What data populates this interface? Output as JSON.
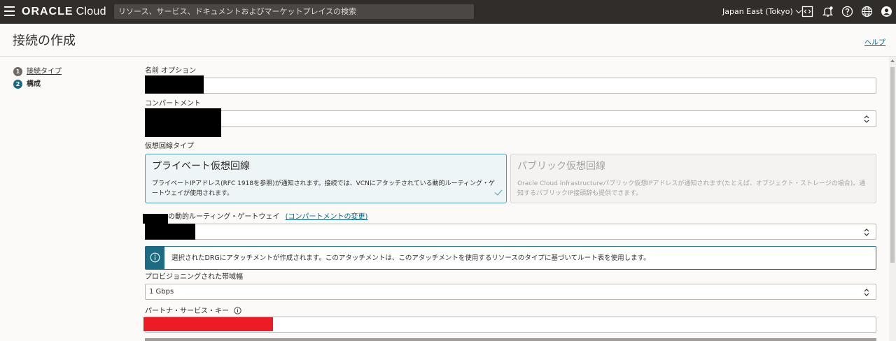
{
  "topbar": {
    "brand_bold": "ORACLE",
    "brand_rest": "Cloud",
    "search_placeholder": "リソース、サービス、ドキュメントおよびマーケットプレイスの検索",
    "region": "Japan East (Tokyo)",
    "icons": [
      "menu-icon",
      "code-editor-icon",
      "bell-icon",
      "help-icon",
      "globe-icon",
      "user-icon"
    ]
  },
  "header": {
    "title": "接続の作成",
    "help": "ヘルプ"
  },
  "steps": [
    {
      "number": "1",
      "label": "接続タイプ"
    },
    {
      "number": "2",
      "label": "構成"
    }
  ],
  "form": {
    "name_label": "名前  オプション",
    "compartment_label": "コンパートメント",
    "circuit_type_label": "仮想回線タイプ",
    "private_title": "プライベート仮想回線",
    "private_desc": "プライベートIPアドレス(RFC 1918を参照)が通知されます。接続では、VCNにアタッチされている動的ルーティング・ゲートウェイが使用されます。",
    "public_title": "パブリック仮想回線",
    "public_desc": "Oracle Cloud Infrastructureパブリック仮想IPアドレスが通知されます(たとえば、オブジェクト・ストレージの場合)。通知するパブリックIP接頭辞も提供できます。",
    "drg_label": "の動的ルーティング・ゲートウェイ",
    "drg_change": "(コンパートメントの変更)",
    "info_message": "選択されたDRGにアタッチメントが作成されます。このアタッチメントは、このアタッチメントを使用するリソースのタイプに基づいてルート表を使用します。",
    "bandwidth_label": "プロビジョニングされた帯域幅",
    "bandwidth_value": "1 Gbps",
    "partner_key_label": "パートナ・サービス・キー"
  },
  "colors": {
    "topbar": "#312d2a",
    "accent": "#1b6b85",
    "link": "#00688c",
    "selected_card_bg": "#eef5f7",
    "redaction": "#000000",
    "redaction_red": "#ed1c24"
  }
}
